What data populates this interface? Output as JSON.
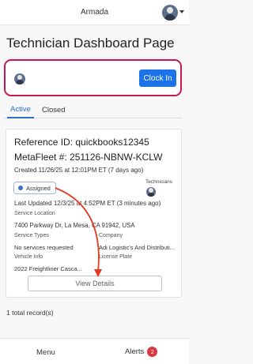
{
  "header": {
    "app_title": "Armada",
    "avatar_icon": "user-avatar-icon",
    "menu_icon": "chevron-down-icon"
  },
  "page": {
    "title": "Technician Dashboard Page"
  },
  "clock": {
    "button_label": "Clock In",
    "button_color": "#1a73e8",
    "highlight_color": "#c5194f"
  },
  "tabs": [
    {
      "label": "Active",
      "selected": true
    },
    {
      "label": "Closed",
      "selected": false
    }
  ],
  "record": {
    "reference_id": "Reference ID: quickbooks12345",
    "metafleet": "MetaFleet #: 251126-NBNW-KCLW",
    "created": "Created 11/26/25 at 12:01PM ET (7 days ago)",
    "status": "Assigned",
    "status_color": "#3d6fd1",
    "technicians_label": "Technicians",
    "last_updated": "Last Updated 12/3/25 at 4:52PM ET (3 minutes ago)",
    "service_location_label": "Service Location",
    "service_location": "7400 Parkway Dr, La Mesa, CA 91942, USA",
    "service_types_label": "Service Types",
    "service_types": "No services requested",
    "company_label": "Company",
    "company": "Adi Logistic's And Distributi...",
    "vehicle_info_label": "Vehicle Info",
    "vehicle_info": "2022 Freightliner Casca...",
    "license_plate_label": "License Plate",
    "view_details_label": "View Details"
  },
  "footer": {
    "total": "1 total record(s)",
    "menu_label": "Menu",
    "alerts_label": "Alerts",
    "alerts_count": "2",
    "alerts_badge_color": "#d9363e"
  }
}
